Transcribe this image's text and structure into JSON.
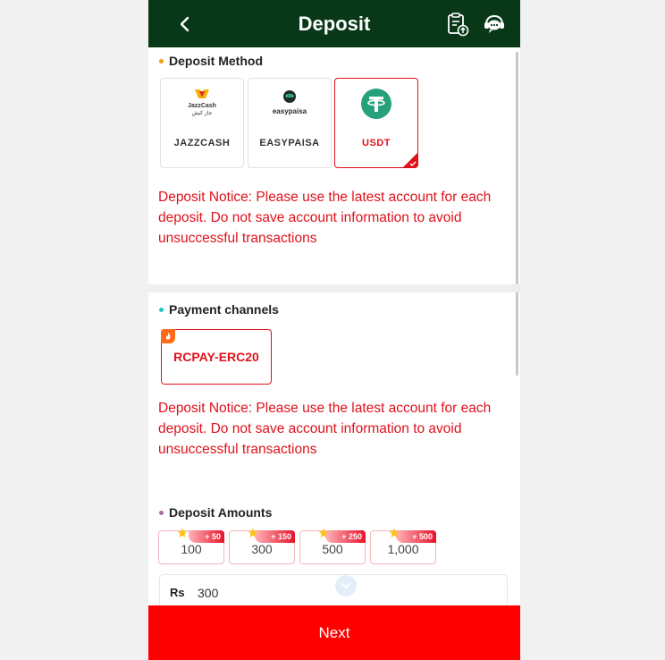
{
  "header": {
    "title": "Deposit"
  },
  "icons": {
    "back": "chevron-left-icon",
    "record": "clipboard-upload-icon",
    "service": "customer-service-icon"
  },
  "deposit_method": {
    "title": "Deposit Method",
    "dot_color": "#f39c12",
    "methods": [
      {
        "label": "JAZZCASH",
        "logo_text": "JazzCash",
        "logo_sub": "جاز کیش",
        "selected": false
      },
      {
        "label": "EASYPAISA",
        "logo_text": "easypaisa",
        "selected": false
      },
      {
        "label": "USDT",
        "selected": true
      }
    ]
  },
  "notice_1": "Deposit Notice: Please use the latest account for each deposit. Do not save account information to avoid unsuccessful transactions",
  "payment_channels": {
    "title": "Payment channels",
    "dot_color": "#22c5c5",
    "channels": [
      {
        "label": "RCPAY-ERC20",
        "selected": true
      }
    ]
  },
  "notice_2": "Deposit Notice: Please use the latest account for each deposit. Do not save account information to avoid unsuccessful transactions",
  "deposit_amounts": {
    "title": "Deposit Amounts",
    "dot_color": "#b06ea0",
    "options": [
      {
        "value": "100",
        "bonus": "+ 50"
      },
      {
        "value": "300",
        "bonus": "+ 150"
      },
      {
        "value": "500",
        "bonus": "+ 250"
      },
      {
        "value": "1,000",
        "bonus": "+ 500"
      }
    ]
  },
  "amount_input": {
    "currency": "Rs",
    "value": "300"
  },
  "next_button": "Next",
  "colors": {
    "header_bg": "#083818",
    "accent_red": "#e0111b",
    "next_bg": "#ff0000",
    "usdt_green": "#26a17b"
  }
}
